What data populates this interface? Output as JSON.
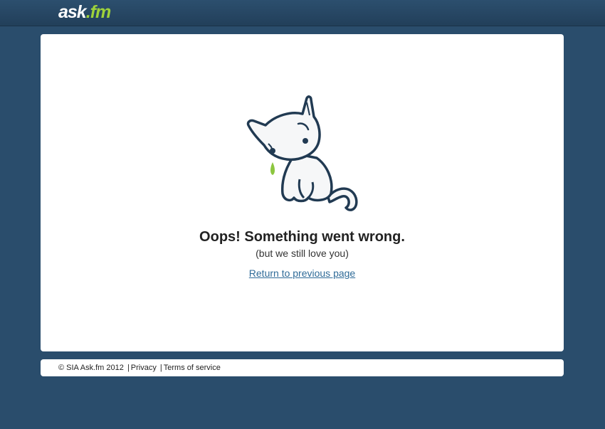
{
  "header": {
    "logo_main": "ask",
    "logo_dot": ".",
    "logo_tld": "fm"
  },
  "error": {
    "illustration": "sad-cat-icon",
    "title": "Oops! Something went wrong.",
    "subtitle": "(but we still love you)",
    "return_link": "Return to previous page"
  },
  "footer": {
    "copyright": "© SIA Ask.fm 2012",
    "separator": "|",
    "privacy": "Privacy",
    "terms": "Terms of service"
  },
  "colors": {
    "background": "#2a4d6c",
    "brand_green": "#9ed23b",
    "link": "#2f6b98"
  }
}
